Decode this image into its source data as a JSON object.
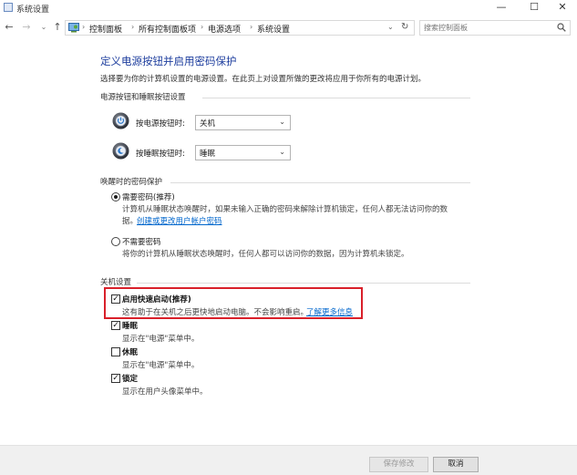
{
  "window": {
    "title": "系统设置",
    "min": "—",
    "max": "☐",
    "close": "✕"
  },
  "nav": {
    "back": "←",
    "forward": "→",
    "dropdown": "⌄",
    "up": "↑"
  },
  "breadcrumb": {
    "items": [
      "控制面板",
      "所有控制面板项",
      "电源选项",
      "系统设置"
    ],
    "separator": "›",
    "dropdown": "⌄",
    "refresh": "↻"
  },
  "search": {
    "placeholder": "搜索控制面板"
  },
  "main": {
    "heading": "定义电源按钮并启用密码保护",
    "subtitle": "选择要为你的计算机设置的电源设置。在此页上对设置所做的更改将应用于你所有的电源计划。"
  },
  "power_section": {
    "title": "电源按钮和睡眠按钮设置",
    "power_button": {
      "label": "按电源按钮时:",
      "value": "关机"
    },
    "sleep_button": {
      "label": "按睡眠按钮时:",
      "value": "睡眠"
    },
    "caret": "⌄"
  },
  "password_section": {
    "title": "唤醒时的密码保护",
    "require": {
      "label": "需要密码(推荐)",
      "desc1": "计算机从睡眠状态唤醒时，如果未输入正确的密码来解除计算机锁定，任何人都无法访问你的数",
      "desc2": "据。",
      "link": "创建或更改用户帐户密码"
    },
    "no_require": {
      "label": "不需要密码",
      "desc": "将你的计算机从睡眠状态唤醒时，任何人都可以访问你的数据，因为计算机未锁定。"
    }
  },
  "shutdown_section": {
    "title": "关机设置",
    "fast_startup": {
      "label": "启用快速启动(推荐)",
      "desc": "这有助于在关机之后更快地启动电脑。不会影响重启。",
      "link": "了解更多信息",
      "checked": true
    },
    "sleep": {
      "label": "睡眠",
      "desc": "显示在\"电源\"菜单中。",
      "checked": true
    },
    "hibernate": {
      "label": "休眠",
      "desc": "显示在\"电源\"菜单中。",
      "checked": false
    },
    "lock": {
      "label": "锁定",
      "desc": "显示在用户头像菜单中。",
      "checked": true
    },
    "check_mark": "✓"
  },
  "footer": {
    "save_label": "保存修改",
    "cancel_label": "取消"
  },
  "colors": {
    "heading": "#1e3e9e",
    "link": "#0066cc",
    "highlight": "#d9202a"
  }
}
